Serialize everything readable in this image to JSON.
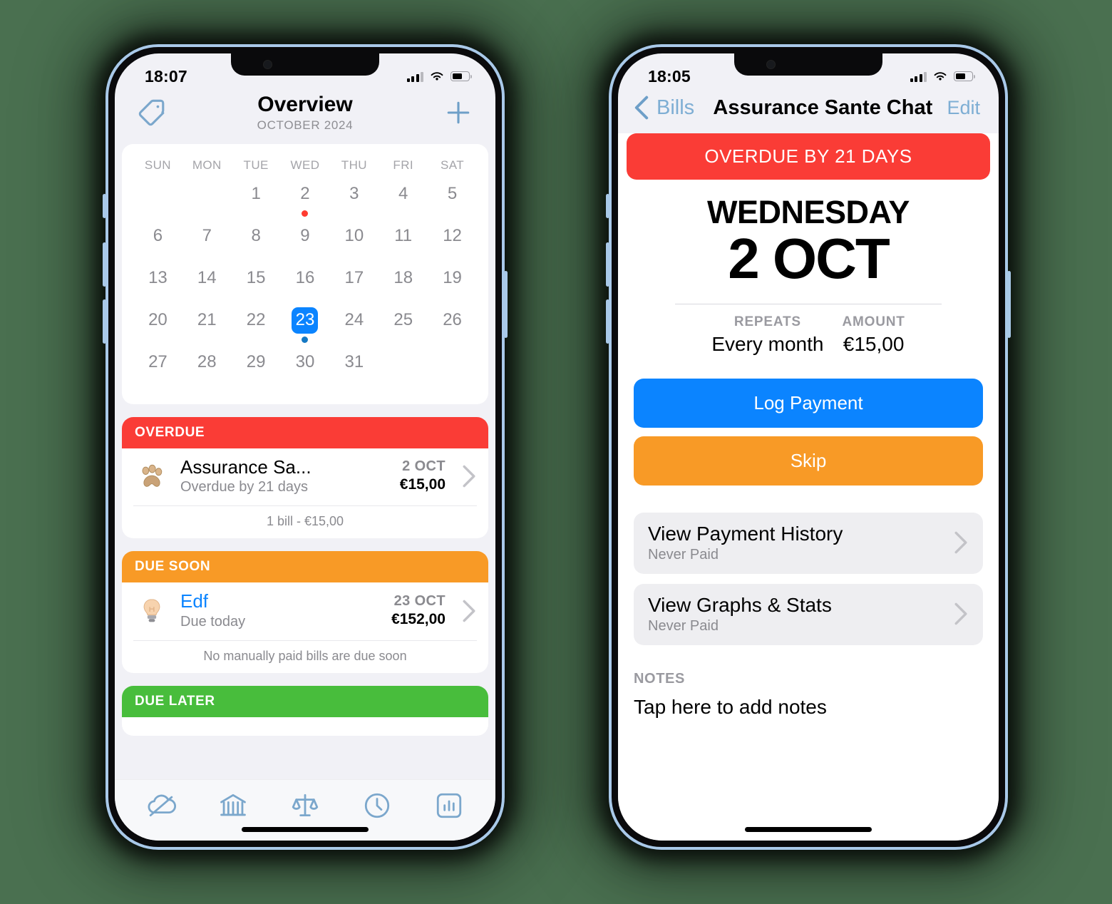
{
  "background_color": "#4a7050",
  "accent_colors": {
    "blue": "#0b84ff",
    "red": "#fa3c36",
    "orange": "#f89a26",
    "green": "#48bd3c",
    "frame_blue": "#a9c9e9",
    "icon_blue": "#7ba7cc"
  },
  "left_phone": {
    "status_bar": {
      "time": "18:07",
      "signal_icon": "cellular-bars-icon",
      "wifi_icon": "wifi-icon",
      "battery_icon": "battery-icon"
    },
    "nav": {
      "tag_icon": "tag-icon",
      "title": "Overview",
      "subtitle": "OCTOBER 2024",
      "add_icon": "plus-icon"
    },
    "calendar": {
      "weekdays": [
        "SUN",
        "MON",
        "TUE",
        "WED",
        "THU",
        "FRI",
        "SAT"
      ],
      "leading_blanks": 2,
      "days": [
        1,
        2,
        3,
        4,
        5,
        6,
        7,
        8,
        9,
        10,
        11,
        12,
        13,
        14,
        15,
        16,
        17,
        18,
        19,
        20,
        21,
        22,
        23,
        24,
        25,
        26,
        27,
        28,
        29,
        30,
        31
      ],
      "selected_day": 23,
      "markers": [
        {
          "day": 2,
          "color": "red"
        },
        {
          "day": 23,
          "color": "blue"
        }
      ]
    },
    "sections": [
      {
        "header": "OVERDUE",
        "header_color": "#fa3c36",
        "rows": [
          {
            "emoji": "paw-print-icon",
            "name": "Assurance Sa...",
            "sub": "Overdue by 21 days",
            "date": "2 OCT",
            "amount": "€15,00",
            "name_color": "black"
          }
        ],
        "footer": "1 bill - €15,00"
      },
      {
        "header": "DUE SOON",
        "header_color": "#f89a26",
        "rows": [
          {
            "emoji": "light-bulb-icon",
            "name": "Edf",
            "sub": "Due today",
            "date": "23 OCT",
            "amount": "€152,00",
            "name_color": "blue"
          }
        ],
        "footer": "No manually paid bills are due soon"
      },
      {
        "header": "DUE LATER",
        "header_color": "#48bd3c",
        "rows": [],
        "footer": ""
      }
    ],
    "tabbar": [
      {
        "icon": "cloud-slash-icon",
        "name": "tab-cloud"
      },
      {
        "icon": "bank-icon",
        "name": "tab-bank"
      },
      {
        "icon": "scales-icon",
        "name": "tab-balance"
      },
      {
        "icon": "clock-icon",
        "name": "tab-history"
      },
      {
        "icon": "bar-chart-icon",
        "name": "tab-stats"
      }
    ]
  },
  "right_phone": {
    "status_bar": {
      "time": "18:05",
      "signal_icon": "cellular-bars-icon",
      "wifi_icon": "wifi-icon",
      "battery_icon": "battery-icon"
    },
    "nav": {
      "back_icon": "chevron-left-icon",
      "back_label": "Bills",
      "title": "Assurance Sante Chat",
      "edit_label": "Edit"
    },
    "banner": "OVERDUE BY 21 DAYS",
    "day_of_week": "WEDNESDAY",
    "date": "2 OCT",
    "meta": [
      {
        "key": "REPEATS",
        "value": "Every month"
      },
      {
        "key": "AMOUNT",
        "value": "€15,00"
      }
    ],
    "buttons": [
      {
        "label": "Log Payment",
        "style": "primary"
      },
      {
        "label": "Skip",
        "style": "warn"
      }
    ],
    "list_items": [
      {
        "title": "View Payment History",
        "sub": "Never Paid"
      },
      {
        "title": "View Graphs & Stats",
        "sub": "Never Paid"
      }
    ],
    "notes": {
      "key": "NOTES",
      "value": "Tap here to add notes"
    }
  }
}
